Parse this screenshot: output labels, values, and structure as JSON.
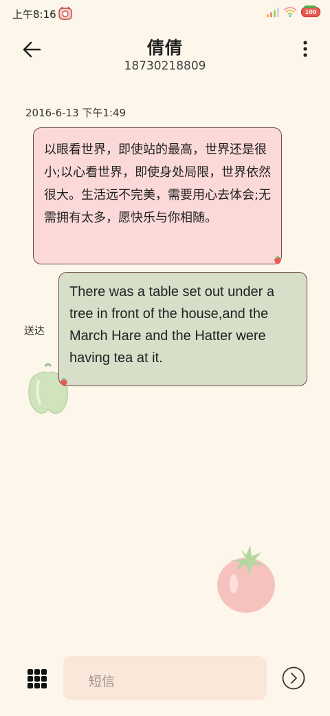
{
  "status_bar": {
    "time": "上午8:16",
    "battery": "100"
  },
  "header": {
    "contact_name": "倩倩",
    "contact_number": "18730218809"
  },
  "conversation": {
    "timestamp": "2016-6-13 下午1:49",
    "messages": [
      {
        "direction": "incoming",
        "text": "以眼看世界，即使站的最高，世界还是很小;以心看世界，即使身处局限，世界依然很大。生活远不完美，需要用心去体会;无需拥有太多，愿快乐与你相随。"
      },
      {
        "direction": "outgoing",
        "text": "There was a table set out under a tree in front of the house,and the March Hare and the Hatter were having tea at it.",
        "status": "送达"
      }
    ]
  },
  "composer": {
    "placeholder": "短信"
  },
  "colors": {
    "background": "#fdf6ea",
    "incoming_bubble": "#fbd9d8",
    "outgoing_bubble": "#d7dfc9",
    "input_background": "#fbe6da"
  },
  "icons": {
    "back": "arrow-left-icon",
    "more": "more-vertical-icon",
    "apps": "grid-icon",
    "send": "send-circle-icon"
  }
}
